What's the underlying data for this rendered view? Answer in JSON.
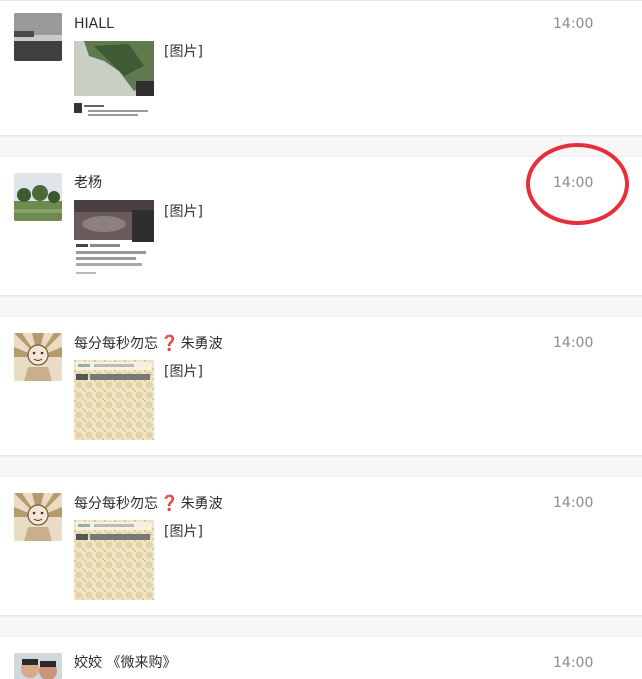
{
  "messages": [
    {
      "name": "HIALL",
      "time": "14:00",
      "preview": "[图片]",
      "avatar": "lake-photo-avatar",
      "thumbnail": "tree-photo-thumbnail"
    },
    {
      "name": "老杨",
      "time": "14:00",
      "preview": "[图片]",
      "avatar": "park-photo-avatar",
      "thumbnail": "pond-photo-thumbnail"
    },
    {
      "name_parts": [
        "每分每秒勿忘",
        "❓",
        "朱勇波"
      ],
      "time": "14:00",
      "preview": "[图片]",
      "avatar": "cartoon-portrait-avatar",
      "thumbnail": "patterned-card-thumbnail"
    },
    {
      "name_parts": [
        "每分每秒勿忘",
        "❓",
        "朱勇波"
      ],
      "time": "14:00",
      "preview": "[图片]",
      "avatar": "cartoon-portrait-avatar",
      "thumbnail": "patterned-card-thumbnail"
    },
    {
      "name": "姣姣 《微来购》",
      "time": "14:00",
      "avatar": "people-photo-avatar"
    }
  ],
  "annotation": {
    "shape": "red-ellipse",
    "color": "#e5303b",
    "target": "time of message 2"
  },
  "colors": {
    "accent": "#e5303b",
    "time_text": "#8c8c8c",
    "name_text": "#2b2b2b",
    "divider": "#e6e6e6"
  }
}
